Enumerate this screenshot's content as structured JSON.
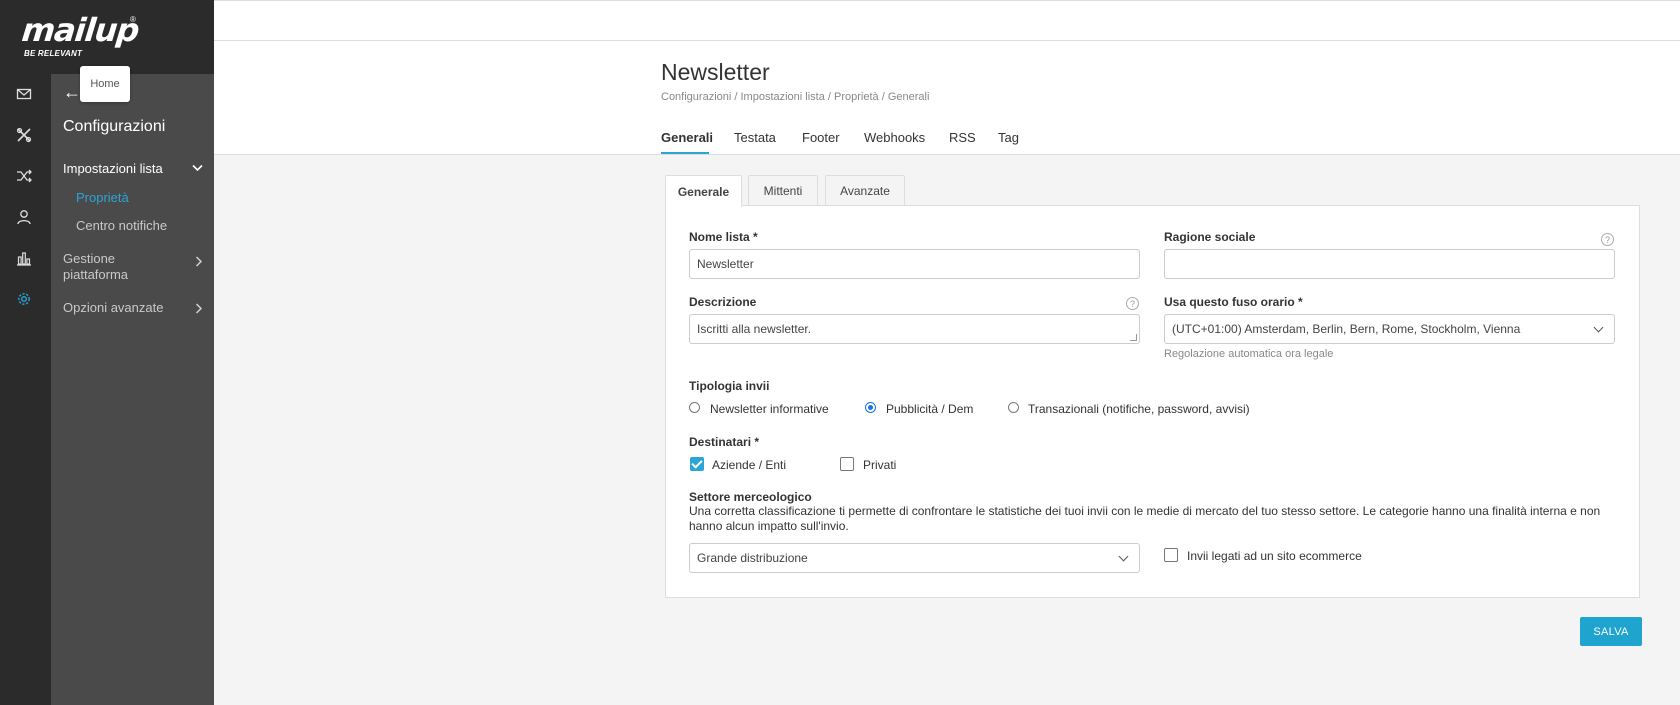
{
  "brand": {
    "logo_text": "mailup",
    "tagline": "BE RELEVANT",
    "registered": "®"
  },
  "tooltip": "Home",
  "rail_icons": [
    "mail-icon",
    "tools-icon",
    "shuffle-icon",
    "user-icon",
    "bar-chart-icon",
    "gear-icon"
  ],
  "sidebar": {
    "back": "←",
    "title": "Configurazioni",
    "section": "Impostazioni lista",
    "items": [
      {
        "label": "Proprietà",
        "active": true
      },
      {
        "label": "Centro notifiche",
        "active": false
      }
    ],
    "groups": [
      {
        "label": "Gestione piattaforma"
      },
      {
        "label": "Opzioni avanzate"
      }
    ]
  },
  "page": {
    "title": "Newsletter",
    "breadcrumb": "Configurazioni / Impostazioni lista / Proprietà / Generali",
    "tabs": [
      "Generali",
      "Testata",
      "Footer",
      "Webhooks",
      "RSS",
      "Tag"
    ],
    "active_tab": "Generali"
  },
  "subtabs": [
    "Generale",
    "Mittenti",
    "Avanzate"
  ],
  "form": {
    "nome_lista": {
      "label": "Nome lista *",
      "value": "Newsletter"
    },
    "ragione_sociale": {
      "label": "Ragione sociale",
      "value": ""
    },
    "descrizione": {
      "label": "Descrizione",
      "value": "Iscritti alla newsletter."
    },
    "fuso_orario": {
      "label": "Usa questo fuso orario *",
      "value": "(UTC+01:00) Amsterdam, Berlin, Bern, Rome, Stockholm, Vienna",
      "hint": "Regolazione automatica ora legale"
    },
    "tipologia": {
      "label": "Tipologia invii",
      "options": [
        "Newsletter informative",
        "Pubblicità / Dem",
        "Transazionali (notifiche, password, avvisi)"
      ],
      "selected": "Pubblicità / Dem"
    },
    "destinatari": {
      "label": "Destinatari *",
      "options": [
        {
          "label": "Aziende / Enti",
          "checked": true
        },
        {
          "label": "Privati",
          "checked": false
        }
      ]
    },
    "settore": {
      "label": "Settore merceologico",
      "description": "Una corretta classificazione ti permette di confrontare le statistiche dei tuoi invii con le medie di mercato del tuo stesso settore. Le categorie hanno una finalità interna e non hanno alcun impatto sull'invio.",
      "value": "Grande distribuzione"
    },
    "ecommerce": {
      "label": "Invii legati ad un sito ecommerce",
      "checked": false
    }
  },
  "save_label": "SALVA",
  "colors": {
    "accent": "#2ba4d6",
    "sidebar_dark": "#2b2b2b",
    "sidebar_panel": "#4a4a4a",
    "radio_blue": "#1a73e8"
  }
}
